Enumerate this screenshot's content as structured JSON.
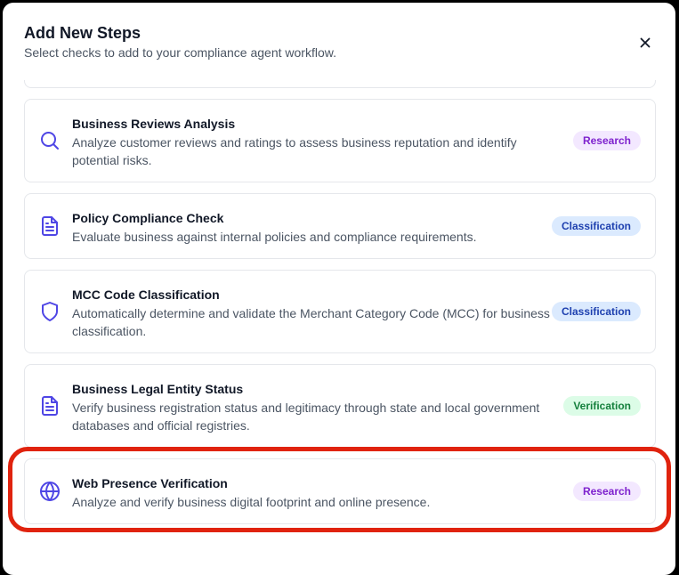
{
  "dialog": {
    "title": "Add New Steps",
    "subtitle": "Select checks to add to your compliance agent workflow."
  },
  "steps": [
    {
      "title": "Business Reviews Analysis",
      "description": "Analyze customer reviews and ratings to assess business reputation and identify potential risks.",
      "badge": "Research",
      "icon": "search-icon"
    },
    {
      "title": "Policy Compliance Check",
      "description": "Evaluate business against internal policies and compliance requirements.",
      "badge": "Classification",
      "icon": "document-icon"
    },
    {
      "title": "MCC Code Classification",
      "description": "Automatically determine and validate the Merchant Category Code (MCC) for business classification.",
      "badge": "Classification",
      "icon": "shield-icon"
    },
    {
      "title": "Business Legal Entity Status",
      "description": "Verify business registration status and legitimacy through state and local government databases and official registries.",
      "badge": "Verification",
      "icon": "document-icon"
    },
    {
      "title": "Web Presence Verification",
      "description": "Analyze and verify business digital footprint and online presence.",
      "badge": "Research",
      "icon": "globe-icon"
    }
  ],
  "colors": {
    "icon": "#4f46e5",
    "research_bg": "#f3e8ff",
    "research_text": "#7e22ce",
    "classification_bg": "#dbeafe",
    "classification_text": "#1e40af",
    "verification_bg": "#dcfce7",
    "verification_text": "#15803d",
    "highlight": "#e0230e"
  }
}
